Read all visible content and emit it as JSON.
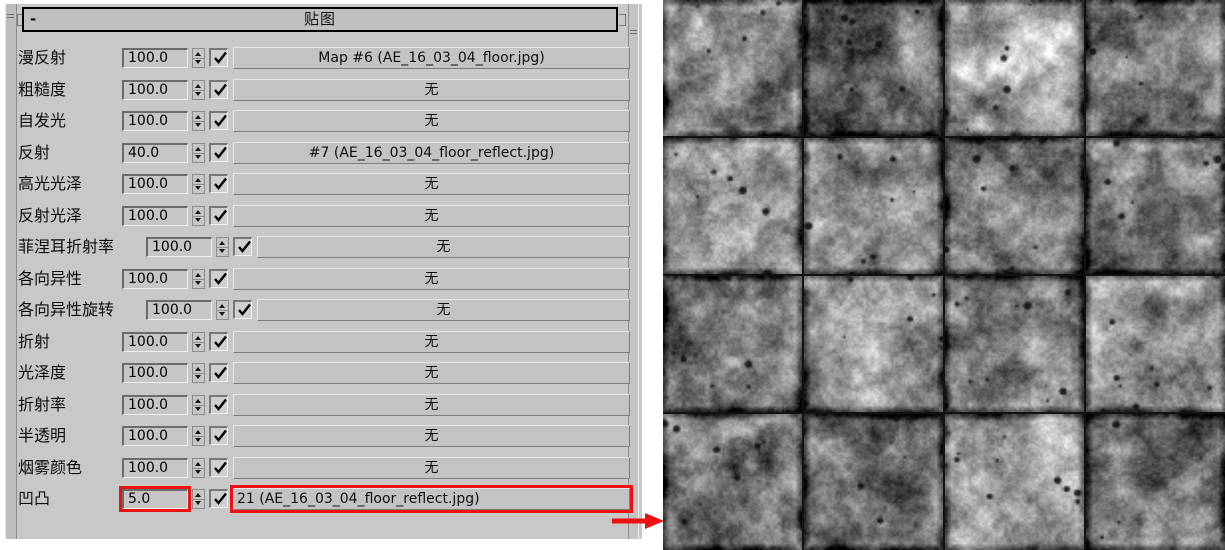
{
  "panel": {
    "title": "贴图",
    "collapse_indicator": "-",
    "rows": [
      {
        "label": "漫反射",
        "amount": "100.0",
        "checked": true,
        "map": "Map #6 (AE_16_03_04_floor.jpg)",
        "wide_label": false,
        "highlight": false
      },
      {
        "label": "粗糙度",
        "amount": "100.0",
        "checked": true,
        "map": "无",
        "wide_label": false,
        "highlight": false
      },
      {
        "label": "自发光",
        "amount": "100.0",
        "checked": true,
        "map": "无",
        "wide_label": false,
        "highlight": false
      },
      {
        "label": "反射",
        "amount": "40.0",
        "checked": true,
        "map": "#7 (AE_16_03_04_floor_reflect.jpg)",
        "wide_label": false,
        "highlight": false
      },
      {
        "label": "高光光泽",
        "amount": "100.0",
        "checked": true,
        "map": "无",
        "wide_label": false,
        "highlight": false
      },
      {
        "label": "反射光泽",
        "amount": "100.0",
        "checked": true,
        "map": "无",
        "wide_label": false,
        "highlight": false
      },
      {
        "label": "菲涅耳折射率",
        "amount": "100.0",
        "checked": true,
        "map": "无",
        "wide_label": true,
        "highlight": false
      },
      {
        "label": "各向异性",
        "amount": "100.0",
        "checked": true,
        "map": "无",
        "wide_label": false,
        "highlight": false
      },
      {
        "label": "各向异性旋转",
        "amount": "100.0",
        "checked": true,
        "map": "无",
        "wide_label": true,
        "highlight": false
      },
      {
        "label": "折射",
        "amount": "100.0",
        "checked": true,
        "map": "无",
        "wide_label": false,
        "highlight": false
      },
      {
        "label": "光泽度",
        "amount": "100.0",
        "checked": true,
        "map": "无",
        "wide_label": false,
        "highlight": false
      },
      {
        "label": "折射率",
        "amount": "100.0",
        "checked": true,
        "map": "无",
        "wide_label": false,
        "highlight": false
      },
      {
        "label": "半透明",
        "amount": "100.0",
        "checked": true,
        "map": "无",
        "wide_label": false,
        "highlight": false
      },
      {
        "label": "烟雾颜色",
        "amount": "100.0",
        "checked": true,
        "map": "无",
        "wide_label": false,
        "highlight": false
      },
      {
        "label": "凹凸",
        "amount": "5.0",
        "checked": true,
        "map": "21 (AE_16_03_04_floor_reflect.jpg)",
        "wide_label": false,
        "highlight": true
      }
    ]
  },
  "annotation": {
    "arrow_color": "#ee1111",
    "highlight_color": "#ee1111",
    "arrow_direction": "right"
  },
  "preview": {
    "name": "floor-texture-preview",
    "tiles_across": 4,
    "tiles_down": 4,
    "grout_color": "#121212",
    "description": "灰度石材地面贴图平铺预览"
  },
  "colors": {
    "panel_background": "#c8c8c8",
    "button_face": "#c3c3c3",
    "field_face": "#c6c6c6",
    "text": "#0d0d0d"
  }
}
